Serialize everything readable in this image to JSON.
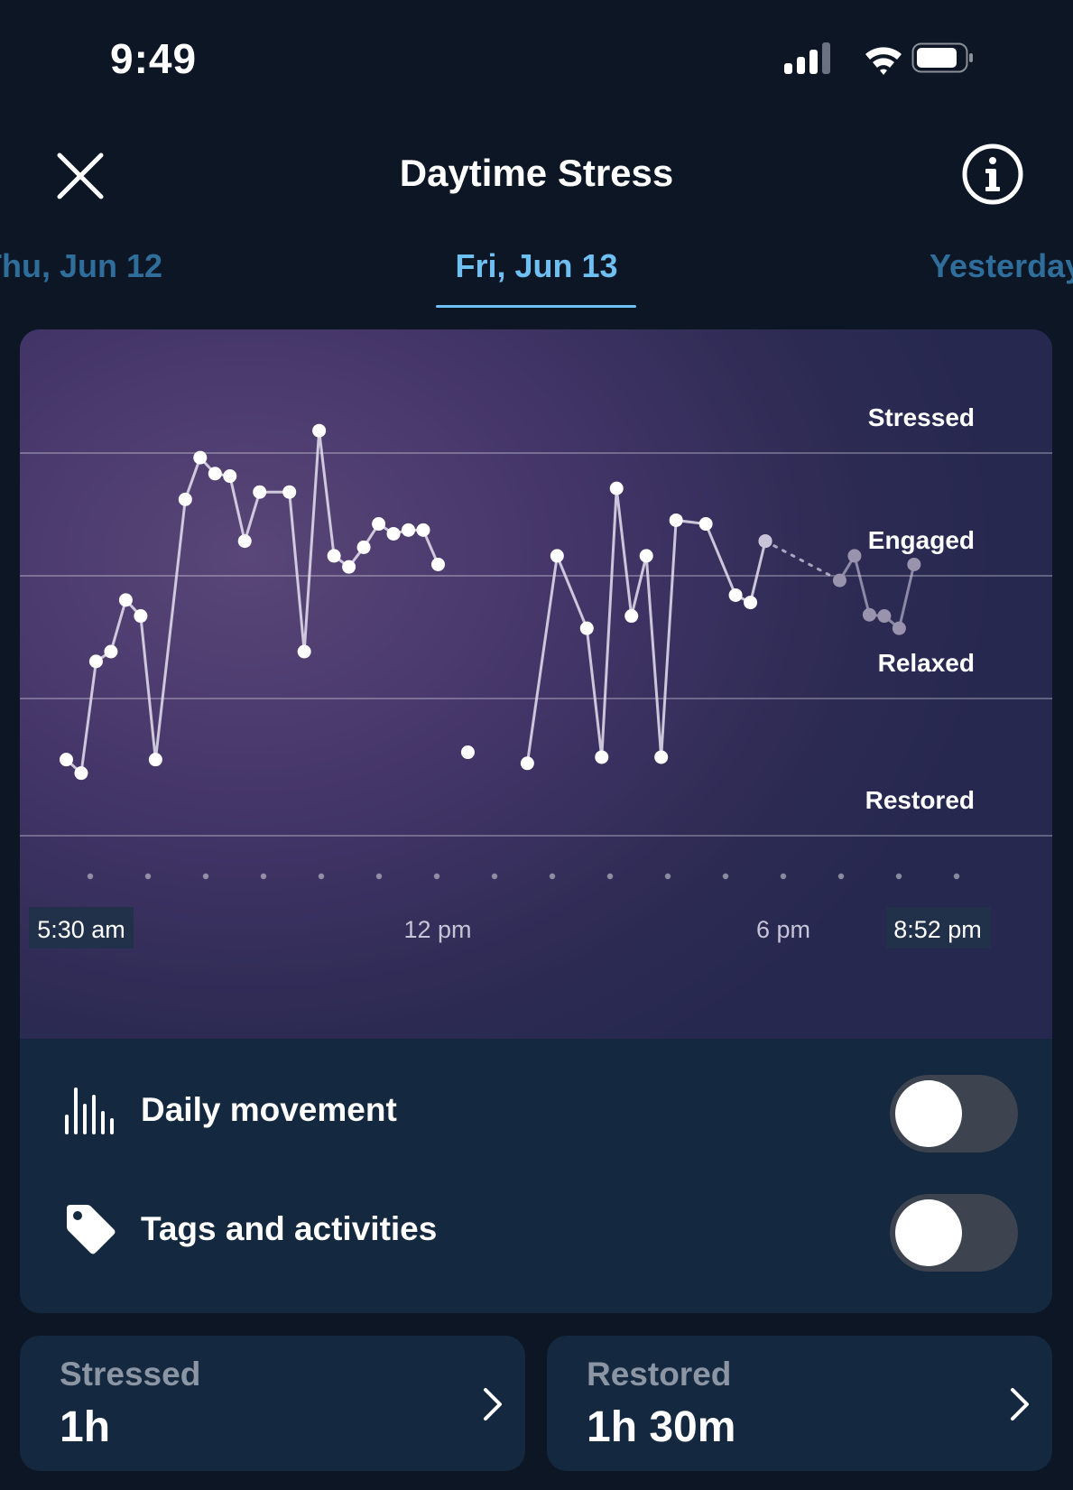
{
  "status_bar": {
    "time": "9:49"
  },
  "header": {
    "title": "Daytime Stress"
  },
  "date_tabs": {
    "previous": "Thu, Jun 12",
    "current": "Fri, Jun 13",
    "next": "Yesterday"
  },
  "chart_data": {
    "type": "line",
    "y_levels": [
      "Stressed",
      "Engaged",
      "Relaxed",
      "Restored"
    ],
    "x_tick_labels": [
      "5:30 am",
      "12 pm",
      "6 pm",
      "8:52 pm"
    ],
    "x_range": [
      "5:30 am",
      "8:52 pm"
    ],
    "series": [
      {
        "points": [
          [
            5.75,
            1.62
          ],
          [
            6.0,
            1.51
          ],
          [
            6.25,
            2.42
          ],
          [
            6.5,
            2.5
          ],
          [
            6.75,
            2.92
          ],
          [
            7.0,
            2.79
          ],
          [
            7.25,
            1.62
          ],
          [
            7.75,
            3.74
          ],
          [
            8.0,
            4.08
          ],
          [
            8.25,
            3.95
          ],
          [
            8.5,
            3.93
          ],
          [
            8.75,
            3.4
          ],
          [
            9.0,
            3.8
          ],
          [
            9.5,
            3.8
          ],
          [
            9.75,
            2.5
          ],
          [
            10.0,
            4.3
          ],
          [
            10.25,
            3.28
          ],
          [
            10.5,
            3.19
          ],
          [
            10.75,
            3.35
          ],
          [
            11.0,
            3.54
          ],
          [
            11.25,
            3.46
          ],
          [
            11.5,
            3.49
          ],
          [
            11.75,
            3.49
          ],
          [
            12.0,
            3.21
          ]
        ]
      },
      {
        "points": [
          [
            12.5,
            1.68
          ]
        ]
      },
      {
        "points": [
          [
            13.5,
            1.59
          ],
          [
            14.0,
            3.28
          ],
          [
            14.5,
            2.69
          ],
          [
            14.75,
            1.64
          ],
          [
            15.0,
            3.83
          ],
          [
            15.25,
            2.79
          ],
          [
            15.5,
            3.28
          ],
          [
            15.75,
            1.64
          ],
          [
            16.0,
            3.57
          ],
          [
            16.5,
            3.54
          ],
          [
            17.0,
            2.96
          ],
          [
            17.25,
            2.9
          ],
          [
            17.5,
            3.4
          ]
        ]
      },
      {
        "estimated": true,
        "points": [
          [
            17.5,
            3.4
          ],
          [
            18.75,
            3.08
          ],
          [
            19.0,
            3.28
          ],
          [
            19.25,
            2.8
          ],
          [
            19.5,
            2.79
          ],
          [
            19.75,
            2.69
          ],
          [
            20.0,
            3.21
          ]
        ]
      }
    ]
  },
  "toggles": [
    {
      "label": "Daily movement",
      "enabled": false,
      "icon": "bars-icon"
    },
    {
      "label": "Tags and activities",
      "enabled": false,
      "icon": "tag-icon"
    }
  ],
  "summary": [
    {
      "label": "Stressed",
      "value": "1h"
    },
    {
      "label": "Restored",
      "value": "1h 30m"
    }
  ],
  "colors": {
    "background": "#0c1624",
    "card": "#14283f",
    "accent": "#6fc0f2",
    "chart_purple": "#45366a"
  }
}
